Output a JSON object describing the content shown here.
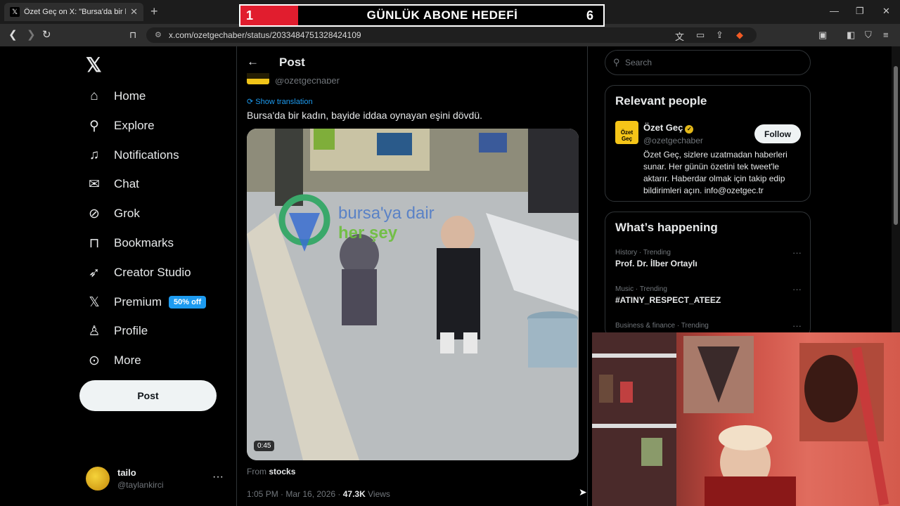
{
  "browser": {
    "tab_title": "Özet Geç on X: \"Bursa'da bir kad",
    "url": "x.com/ozetgechaber/status/2033484751328424109"
  },
  "overlay": {
    "left_number": "1",
    "label": "GÜNLÜK ABONE HEDEFİ",
    "right_number": "6"
  },
  "nav": {
    "items": [
      {
        "label": "Home",
        "icon": "home-icon"
      },
      {
        "label": "Explore",
        "icon": "search-icon"
      },
      {
        "label": "Notifications",
        "icon": "bell-icon"
      },
      {
        "label": "Chat",
        "icon": "mail-icon"
      },
      {
        "label": "Grok",
        "icon": "grok-icon"
      },
      {
        "label": "Bookmarks",
        "icon": "bookmark-icon"
      },
      {
        "label": "Creator Studio",
        "icon": "rocket-icon"
      },
      {
        "label": "Premium",
        "icon": "x-icon"
      },
      {
        "label": "Profile",
        "icon": "person-icon"
      },
      {
        "label": "More",
        "icon": "more-circle-icon"
      }
    ],
    "premium_badge": "50% off",
    "post_button": "Post"
  },
  "account": {
    "name": "tailo",
    "handle": "@taylankirci"
  },
  "post": {
    "header_title": "Post",
    "handle": "@ozetgechaber",
    "show_translation": "Show translation",
    "text": "Bursa'da bir kadın, bayide iddaa oynayan eşini dövdü.",
    "video_duration": "0:45",
    "watermark_line1": "bursa'ya dair",
    "watermark_line2": "her şey",
    "from_label": "From",
    "from_source": "stocks",
    "time": "1:05 PM · Mar 16, 2026 · ",
    "views_count": "47.3K",
    "views_label": "Views"
  },
  "sidebar": {
    "search_placeholder": "Search",
    "relevant_title": "Relevant people",
    "person": {
      "name": "Özet Geç",
      "handle": "@ozetgechaber",
      "avatar_text": "Özet Geç",
      "follow_label": "Follow",
      "bio": "Özet Geç, sizlere uzatmadan haberleri sunar. Her günün özetini tek tweet'le aktarır. Haberdar olmak için takip edip bildirimleri açın. info@ozetgec.tr"
    },
    "happening_title": "What’s happening",
    "trends": [
      {
        "category": "History · Trending",
        "name": "Prof. Dr. İlber Ortaylı"
      },
      {
        "category": "Music · Trending",
        "name": "#ATINY_RESPECT_ATEEZ"
      },
      {
        "category": "Business & finance · Trending",
        "name": ""
      }
    ]
  },
  "colors": {
    "background": "#000000",
    "accent": "#1d9bf0",
    "banner_red": "#e11d2e",
    "text_secondary": "#71767b"
  }
}
